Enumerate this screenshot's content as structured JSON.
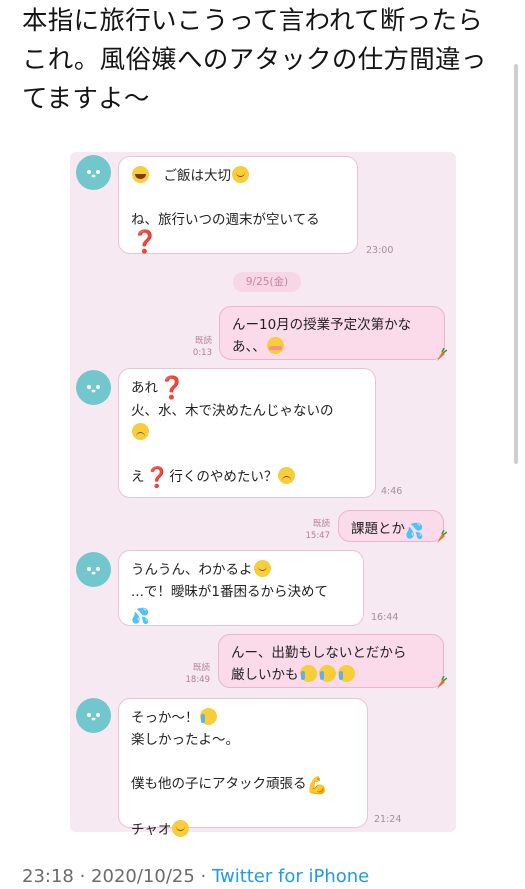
{
  "tweet": {
    "text": "本指に旅行いこうって言われて断ったらこれ。風俗嬢へのアタックの仕方間違ってますよ〜"
  },
  "chat": {
    "date_separator": "9/25(金)",
    "messages": [
      {
        "id": "m1",
        "direction": "in",
        "time": "23:00",
        "lines": [
          [
            {
              "e": "hug-emoji"
            },
            {
              "t": "　ご飯は大切"
            },
            {
              "e": "smile-emoji"
            }
          ],
          [
            {
              "t": " "
            }
          ],
          [
            {
              "t": "ね、旅行いつの週末が空いてる"
            }
          ],
          [
            {
              "g": "❓",
              "cls": "q",
              "name": "question-mark-emoji"
            }
          ]
        ]
      },
      {
        "id": "m2",
        "direction": "out",
        "time": "0:13",
        "read": "既読",
        "lines": [
          [
            {
              "t": "んー10月の授業予定次第かな"
            }
          ],
          [
            {
              "t": "あ、、"
            },
            {
              "e": "flush-emoji"
            }
          ]
        ]
      },
      {
        "id": "m3",
        "direction": "in",
        "time": "4:46",
        "lines": [
          [
            {
              "t": "あれ"
            },
            {
              "g": "❓",
              "cls": "q",
              "name": "question-mark-emoji"
            }
          ],
          [
            {
              "t": "火、水、木で決めたんじゃないの"
            }
          ],
          [
            {
              "e": "worried-emoji"
            }
          ],
          [
            {
              "t": " "
            }
          ],
          [
            {
              "t": "え"
            },
            {
              "g": "❓",
              "cls": "qk",
              "name": "black-question-mark-emoji"
            },
            {
              "t": "行くのやめたい？"
            },
            {
              "e": "sad-emoji"
            }
          ]
        ]
      },
      {
        "id": "m4",
        "direction": "out",
        "time": "15:47",
        "read": "既読",
        "lines": [
          [
            {
              "t": "課題とか"
            },
            {
              "g": "💦",
              "cls": "sweat",
              "name": "sweat-drops-emoji"
            }
          ]
        ]
      },
      {
        "id": "m5",
        "direction": "in",
        "time": "16:44",
        "lines": [
          [
            {
              "t": "うんうん、わかるよ"
            },
            {
              "e": "smile-emoji"
            }
          ],
          [
            {
              "t": "...で！曖昧が1番困るから決めて"
            }
          ],
          [
            {
              "g": "💦",
              "cls": "sweat",
              "name": "sweat-drops-emoji"
            }
          ]
        ]
      },
      {
        "id": "m6",
        "direction": "out",
        "time": "18:49",
        "read": "既読",
        "lines": [
          [
            {
              "t": "んー、出勤もしないとだから"
            }
          ],
          [
            {
              "t": "厳しいかも"
            },
            {
              "e": "crying-emoji"
            },
            {
              "e": "crying-emoji"
            },
            {
              "e": "crying-emoji"
            }
          ]
        ]
      },
      {
        "id": "m7",
        "direction": "in",
        "time": "21:24",
        "lines": [
          [
            {
              "t": "そっか〜！"
            },
            {
              "e": "crying-emoji"
            }
          ],
          [
            {
              "t": "楽しかったよ〜。"
            }
          ],
          [
            {
              "t": " "
            }
          ],
          [
            {
              "t": "僕も他の子にアタック頑張る"
            },
            {
              "g": "💪",
              "cls": "muscle",
              "name": "flexed-biceps-emoji"
            }
          ],
          [
            {
              "t": " "
            }
          ],
          [
            {
              "t": "チャオ"
            },
            {
              "e": "smile-emoji"
            }
          ]
        ]
      }
    ]
  },
  "footer": {
    "timestamp": "23:18 · 2020/10/25 · ",
    "source": "Twitter for iPhone"
  },
  "colors": {
    "chat_background": "#f6e9f1",
    "outgoing_bubble": "#fbdbea",
    "incoming_bubble": "#ffffff",
    "avatar": "#72c7cd",
    "link": "#1d9bf0"
  }
}
